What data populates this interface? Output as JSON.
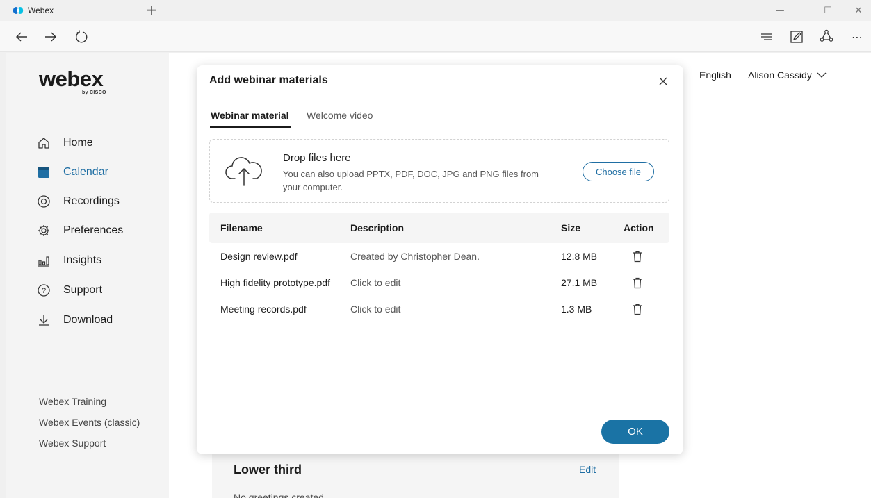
{
  "browser": {
    "tab_title": "Webex",
    "new_tab": "+",
    "window_controls": {
      "minimize": "—",
      "maximize": "☐",
      "close": "✕"
    },
    "more": "⋯"
  },
  "sidebar": {
    "brand": "webex",
    "brand_sub": "by CISCO",
    "items": [
      {
        "label": "Home",
        "icon": "home-icon",
        "active": false
      },
      {
        "label": "Calendar",
        "icon": "calendar-icon",
        "active": true
      },
      {
        "label": "Recordings",
        "icon": "recordings-icon",
        "active": false
      },
      {
        "label": "Preferences",
        "icon": "gear-icon",
        "active": false
      },
      {
        "label": "Insights",
        "icon": "insights-icon",
        "active": false
      },
      {
        "label": "Support",
        "icon": "help-icon",
        "active": false
      },
      {
        "label": "Download",
        "icon": "download-icon",
        "active": false
      }
    ],
    "footer_links": [
      "Webex Training",
      "Webex Events (classic)",
      "Webex Support"
    ]
  },
  "header": {
    "language": "English",
    "user_name": "Alison Cassidy"
  },
  "background_card": {
    "title": "Lower third",
    "edit_label": "Edit",
    "empty_text": "No greetings created"
  },
  "modal": {
    "title": "Add webinar materials",
    "tabs": [
      "Webinar material",
      "Welcome video"
    ],
    "dropzone": {
      "title": "Drop files here",
      "subtitle": "You can also upload PPTX, PDF, DOC, JPG and PNG files from your computer.",
      "button": "Choose file"
    },
    "table": {
      "headers": [
        "Filename",
        "Description",
        "Size",
        "Action"
      ],
      "rows": [
        {
          "filename": "Design review.pdf",
          "description": "Created by Christopher Dean.",
          "size": "12.8 MB"
        },
        {
          "filename": "High fidelity prototype.pdf",
          "description": "Click to edit",
          "size": "27.1 MB"
        },
        {
          "filename": "Meeting records.pdf",
          "description": "Click to edit",
          "size": "1.3 MB"
        }
      ]
    },
    "ok_label": "OK"
  },
  "colors": {
    "accent": "#1f6ea3",
    "ok_button": "#1a73a5",
    "sidebar_bg": "#f4f4f4"
  }
}
